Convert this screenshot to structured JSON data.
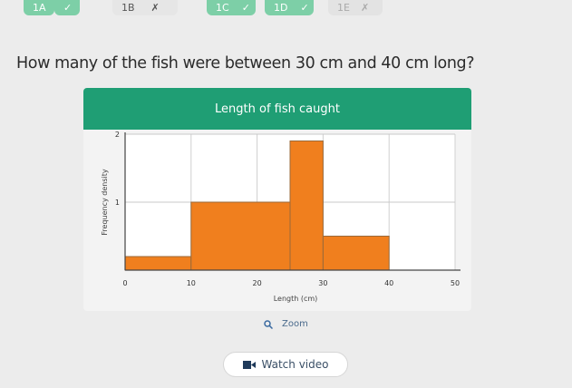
{
  "tabs": [
    {
      "label": "1A",
      "status": "correct"
    },
    {
      "label": "1B",
      "status": "wrong"
    },
    {
      "label": "1C",
      "status": "correct"
    },
    {
      "label": "1D",
      "status": "correct"
    },
    {
      "label": "1E",
      "status": "wrong"
    }
  ],
  "question": "How many of the fish were between 30 cm and 40 cm long?",
  "chart_title": "Length of fish caught",
  "colors": {
    "header": "#1f9e74",
    "bars": "#f07f1e",
    "tab_done": "#7dcfa7"
  },
  "chart_data": {
    "type": "bar",
    "title": "Length of fish caught",
    "xlabel": "Length (cm)",
    "ylabel": "Frequency density",
    "x_ticks": [
      "0",
      "10",
      "20",
      "30",
      "40",
      "50"
    ],
    "y_ticks": [
      "1",
      "2"
    ],
    "xlim": [
      0,
      50
    ],
    "ylim": [
      0,
      2
    ],
    "grid": true,
    "bins": [
      {
        "from": 0,
        "to": 10,
        "density": 0.2
      },
      {
        "from": 10,
        "to": 25,
        "density": 1.0
      },
      {
        "from": 25,
        "to": 30,
        "density": 1.9
      },
      {
        "from": 30,
        "to": 40,
        "density": 0.5
      }
    ]
  },
  "zoom_label": "Zoom",
  "video_label": "Watch video"
}
